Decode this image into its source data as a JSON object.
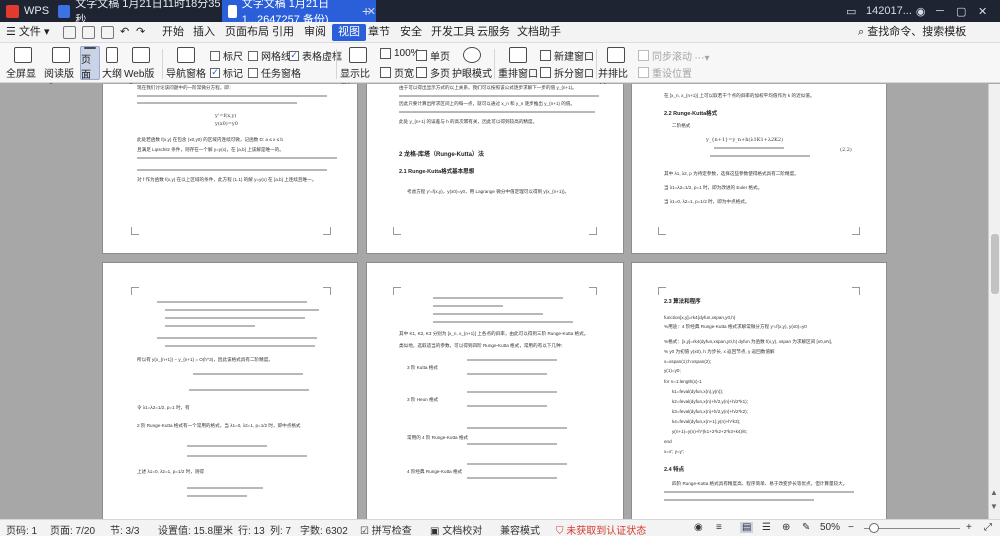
{
  "titlebar": {
    "app_tab": "WPS",
    "tab1": "文字文稿 1月21日11时18分35秒",
    "tab2": "文字文稿 1月21日1...2647257 备份)",
    "user": "142017..."
  },
  "menubar": {
    "file": "文件",
    "items": [
      "开始",
      "插入",
      "页面布局",
      "引用",
      "审阅",
      "视图",
      "章节",
      "安全",
      "开发工具",
      "云服务",
      "文档助手"
    ],
    "search": "查找命令、搜索模板"
  },
  "ribbon": {
    "fullscreen": "全屏显示",
    "reading": "阅读版式",
    "page": "页面",
    "outline": "大纲",
    "web": "Web版式",
    "navpane": "导航窗格",
    "ruler": "标尺",
    "gridlines": "网格线",
    "markers": "标记",
    "tablegrid": "表格虚框",
    "taskpane": "任务窗格",
    "zoom_ratio": "显示比例",
    "zoom100": "100%",
    "pagewidth": "页宽",
    "single": "单页",
    "multi": "多页",
    "eyecare": "护眼模式",
    "rearrange": "重排窗口",
    "newwindow": "新建窗口",
    "split": "拆分窗口",
    "sidebyside": "并排比较",
    "sync_scroll": "同步滚动",
    "reset_pos": "重设位置"
  },
  "document": {
    "p1": {
      "lines": [
        "现在我们讨论该问题中的一阶常微分方程，即：",
        "y'=f(x,y)",
        "y(x0)=y0",
        "此处若函数 f(x,y) 在包含 (x0,y0) 的区域内连续可微，记函数 D: a ≤ x ≤ b",
        "且满足 Lipschitz 条件，则存在一个解 y=y(x)，在 [a,b] 上该解是唯一的。",
        "对 f 作为函数 f(x,y) 在以上区域的条件，此方程 (1.1) 的解 y=y(x) 在 [a,b] 上连续且唯一。"
      ]
    },
    "p2": {
      "lines": [
        "由于可以得出显示方式的以上关系，我们可以按照该公式逐步求解下一步的值 y_{n+1}。",
        "因此只要计算出所求区间上的每一点，就可以通过 x_n 和 y_n 逐步推出 y_{n+1} 的值。",
        "此处 y_{n+1} 的误差与 h 的高次幂有关，因此可以得到较高的精度。"
      ],
      "h1": "2 龙格-库塔（Runge-Kutta）法",
      "h2": "2.1 Runge-Kutta格式基本思想",
      "body": "考虑方程 y'=f(x,y)，y(x0)=y0，用 Lagrange 微分中值定理可以得到 y(x_{n+1})。"
    },
    "p3": {
      "top": "在 [x_n, x_{n+1}] 上可以取若干个点的斜率的加权平均值作为 k 的近似值。",
      "h": "2.2 Runge-Kutta格式",
      "sub": "二阶格式",
      "eq": "y_{n+1}=y_n+h(λ1K1+λ2K2)",
      "eqnum": "(2.2)",
      "lines": [
        "其中 λ1, λ2, p 为待定参数，选择这些参数使得格式具有二阶精度。",
        "当 λ1=λ2=1/2, p=1 时，即为改进的 Euler 格式。",
        "当 λ1=0, λ2=1, p=1/2 时，即为中点格式。"
      ]
    },
    "p4": {
      "lines": [
        "所以有 y(x_{n+1}) − y_{n+1} = O(h^3)，因此该格式具有二阶精度。",
        "令 λ1=λ2=1/2, p=1 时，有",
        "2 阶 Runge-Kutta 格式有一个常用的格式，当 λ1=0, λ2=1, p=1/2 时，即中点格式",
        "上述 λ1=0, λ2=1, p=1/2 时，则得"
      ]
    },
    "p5": {
      "lines": [
        "其中 K1, K2, K3 分别为 [x_n, x_{n+1}] 上各点的斜率，由此可以得到三阶 Runge-Kutta 格式。",
        "类似地，选取适当的参数，可以得到四阶 Runge-Kutta 格式，常用的有以下几种：",
        "3 阶 Kutta 格式",
        "3 阶 Heun 格式",
        "常用的 4 阶 Runge-Kutta 格式",
        "4 阶经典 Runge-Kutta 格式"
      ]
    },
    "p6": {
      "h": "2.3 算法和程序",
      "lines": [
        "function[x,y]=rk4(dyfun,xspan,y0,h)",
        "%用途：4 阶经典 Runge-Kutta 格式求解常微分方程 y'=f(x,y), y(x0)=y0",
        "%格式：[x,y]=rk4(dyfun,xspan,y0,h) dyfun 为函数 f(x,y), xspan 为求解区间 [x0,xN],",
        "%      y0 为初值 y(x0), h 为步长, x 返回节点, y 返回数值解",
        "x=xspan(1):h:xspan(2);",
        "y(1)=y0;",
        "for n=1:length(x)-1",
        "  k1=feval(dyfun,x(n),y(n));",
        "  k2=feval(dyfun,x(n)+h/2,y(n)+h/2*k1);",
        "  k3=feval(dyfun,x(n)+h/2,y(n)+h/2*k2);",
        "  k4=feval(dyfun,x(n+1),y(n)+h*k3);",
        "  y(n+1)=y(n)+h*(k1+2*k2+2*k3+k4)/6;",
        "end",
        "x=x'; y=y';"
      ],
      "h2": "2.4 特点",
      "tail": "四阶 Runge-Kutta 格式具有精度高、程序简单、易于改变步长等优点，但计算量较大。"
    }
  },
  "statusbar": {
    "page": "页码: 1",
    "pages": "页面: 7/20",
    "section": "节: 3/3",
    "setting": "设置值: 15.8厘米",
    "row": "行: 13",
    "col": "列: 7",
    "words": "字数: 6302",
    "spell": "拼写检查",
    "proof": "文档校对",
    "compat": "兼容模式",
    "cert": "未获取到认证状态",
    "zoom": "50%"
  },
  "colors": {
    "accent": "#2b5fd9",
    "titlebar": "#1f2432",
    "cert_red": "#d23b2f"
  }
}
